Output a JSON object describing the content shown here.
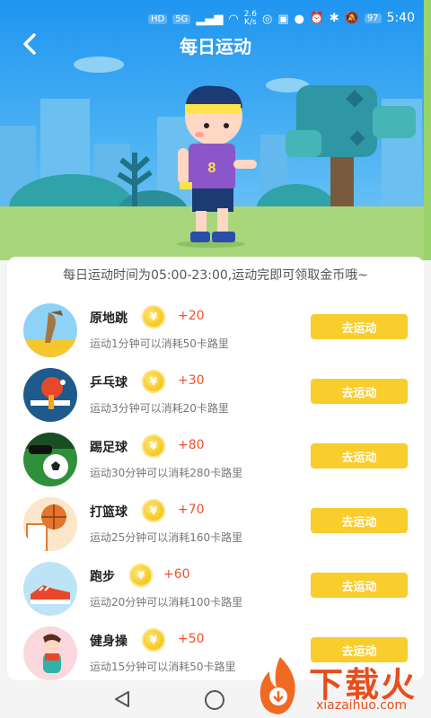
{
  "status_bar": {
    "network_badges": [
      "HD",
      "5G"
    ],
    "speed_value": "2.6",
    "speed_unit": "K/s",
    "battery": "97",
    "time": "5:40"
  },
  "header": {
    "title": "每日运动"
  },
  "notice": "每日运动时间为05:00-23:00,运动完即可领取金币哦~",
  "coin_symbol": "¥",
  "items": [
    {
      "name": "原地跳",
      "reward": "+20",
      "desc": "运动1分钟可以消耗50卡路里",
      "button": "去运动"
    },
    {
      "name": "乒乓球",
      "reward": "+30",
      "desc": "运动3分钟可以消耗20卡路里",
      "button": "去运动"
    },
    {
      "name": "踢足球",
      "reward": "+80",
      "desc": "运动30分钟可以消耗280卡路里",
      "button": "去运动"
    },
    {
      "name": "打篮球",
      "reward": "+70",
      "desc": "运动25分钟可以消耗160卡路里",
      "button": "去运动"
    },
    {
      "name": "跑步",
      "reward": "+60",
      "desc": "运动20分钟可以消耗100卡路里",
      "button": "去运动"
    },
    {
      "name": "健身操",
      "reward": "+50",
      "desc": "运动15分钟可以消耗50卡路里",
      "button": "去运动"
    }
  ],
  "watermark": {
    "brand": "下载火",
    "url": "xiazaihuo.com"
  },
  "icons": [
    "back-arrow-icon",
    "nav-back-icon",
    "nav-home-icon",
    "coin-icon"
  ],
  "colors": {
    "accent_button": "#f8cd2c",
    "reward_text": "#f04f2b",
    "header_blue": "#1f95f0"
  }
}
